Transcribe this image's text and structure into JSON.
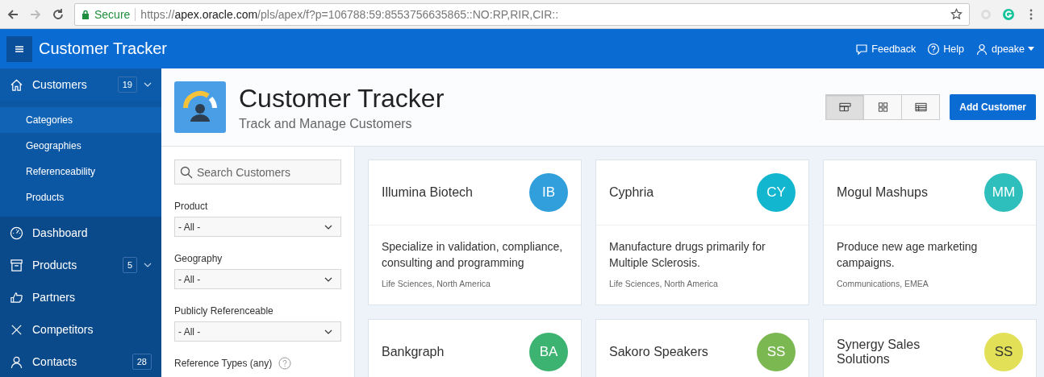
{
  "browser": {
    "secure_label": "Secure",
    "url_scheme": "https://",
    "url_host": "apex.oracle.com",
    "url_path": "/pls/apex/f?p=106788:59:8553756635865::NO:RP,RIR,CIR::"
  },
  "header": {
    "app_title": "Customer Tracker",
    "links": [
      {
        "kind": "feedback",
        "label": "Feedback"
      },
      {
        "kind": "help",
        "label": "Help"
      },
      {
        "kind": "user",
        "label": "dpeake"
      }
    ]
  },
  "sidebar": {
    "items": [
      {
        "kind": "home",
        "label": "Customers",
        "badge": "19",
        "selected": true,
        "expanded": true,
        "children": [
          {
            "label": "Categories",
            "selected": true
          },
          {
            "label": "Geographies",
            "selected": false
          },
          {
            "label": "Referenceability",
            "selected": false
          },
          {
            "label": "Products",
            "selected": false
          }
        ]
      },
      {
        "kind": "dashboard",
        "label": "Dashboard",
        "selected": false
      },
      {
        "kind": "archive",
        "label": "Products",
        "badge": "5",
        "selected": false,
        "expanded": false
      },
      {
        "kind": "thumb",
        "label": "Partners",
        "selected": false
      },
      {
        "kind": "cross",
        "label": "Competitors",
        "selected": false
      },
      {
        "kind": "person",
        "label": "Contacts",
        "badge": "28",
        "selected": false
      }
    ]
  },
  "page": {
    "title": "Customer Tracker",
    "subtitle": "Track and Manage Customers",
    "views": [
      {
        "kind": "cards",
        "selected": true
      },
      {
        "kind": "grid",
        "selected": false
      },
      {
        "kind": "table",
        "selected": false
      }
    ],
    "add_button": "Add Customer"
  },
  "filters": {
    "search": {
      "placeholder": "Search Customers"
    },
    "selects": [
      {
        "label": "Product",
        "value": "- All -"
      },
      {
        "label": "Geography",
        "value": "- All -"
      },
      {
        "label": "Publicly Referenceable",
        "value": "- All -"
      }
    ],
    "reference_types": {
      "label": "Reference Types (any)"
    }
  },
  "customers": [
    {
      "name": "Illumina Biotech",
      "initials": "IB",
      "color": "#309fdb",
      "description": "Specialize in validation, compliance, consulting and programming",
      "tags": "Life Sciences, North America"
    },
    {
      "name": "Cyphria",
      "initials": "CY",
      "color": "#13b6cf",
      "description": "Manufacture drugs primarily for Multiple Sclerosis.",
      "tags": "Life Sciences, North America"
    },
    {
      "name": "Mogul Mashups",
      "initials": "MM",
      "color": "#2ebfbc",
      "description": "Produce new age marketing campaigns.",
      "tags": "Communications, EMEA"
    },
    {
      "name": "Bankgraph",
      "initials": "BA",
      "color": "#3cb371"
    },
    {
      "name": "Sakoro Speakers",
      "initials": "SS",
      "color": "#7cb852"
    },
    {
      "name": "Synergy Sales Solutions",
      "initials": "SS",
      "color": "#e1e056",
      "dark_text": true
    }
  ]
}
